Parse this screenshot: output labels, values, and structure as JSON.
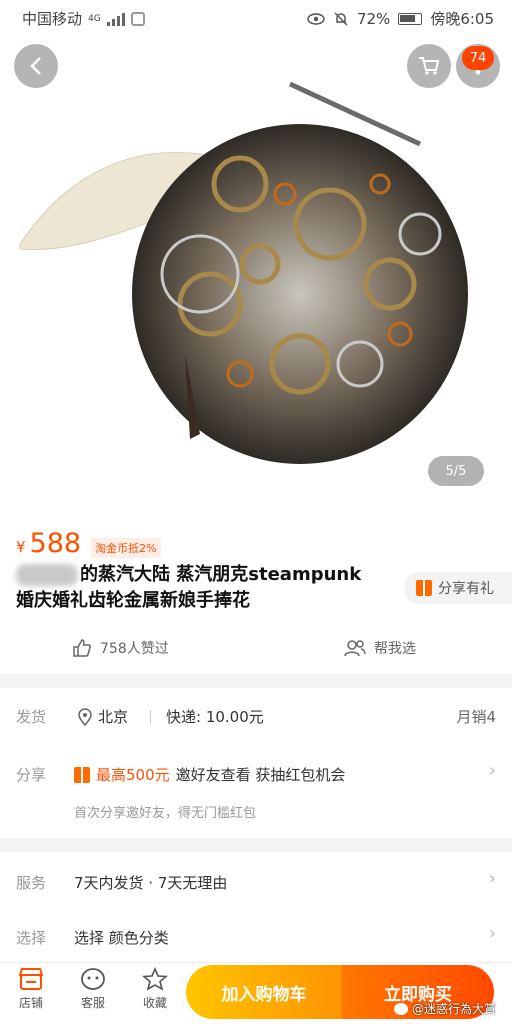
{
  "status_bar": {
    "carrier": "中国移动",
    "network": "4G",
    "battery": "72%",
    "time": "傍晚6:05"
  },
  "hero": {
    "page_indicator": "5/5",
    "notification_count": "74"
  },
  "product": {
    "currency": "¥",
    "price": "588",
    "coin_tag": "淘金币抵2%",
    "title_line1": "的蒸汽大陆 蒸汽朋克steampunk",
    "title_line2": "婚庆婚礼齿轮金属新娘手捧花",
    "share_gift": "分享有礼",
    "likes": "758人赞过",
    "help_choose": "帮我选"
  },
  "shipping": {
    "label": "发货",
    "location": "北京",
    "fee": "快递: 10.00元",
    "monthly_sales": "月销4"
  },
  "share": {
    "label": "分享",
    "red_text": "最高500元",
    "text": "邀好友查看 获抽红包机会",
    "sub": "首次分享邀好友，得无门槛红包"
  },
  "service": {
    "label": "服务",
    "value": "7天内发货 · 7天无理由"
  },
  "select": {
    "label": "选择",
    "value": "选择 颜色分类"
  },
  "bottom_bar": {
    "shop": "店铺",
    "service": "客服",
    "favorite": "收藏",
    "add_to_cart": "加入购物车",
    "buy_now": "立即购买"
  },
  "watermark": "@迷惑行為大賞",
  "colors": {
    "accent": "#ff5000",
    "cart_btn": "#ffa200",
    "buy_btn": "#ff5500"
  }
}
